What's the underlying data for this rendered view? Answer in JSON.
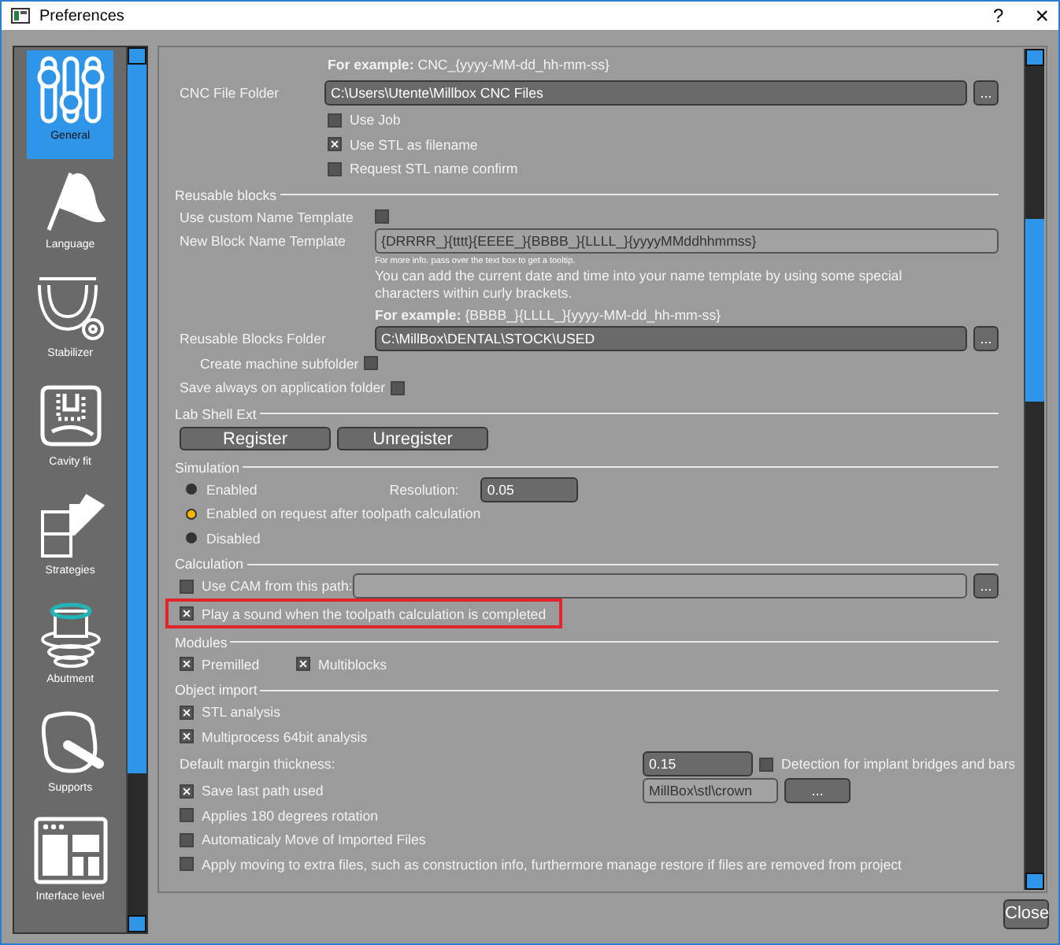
{
  "window": {
    "title": "Preferences",
    "help": "?",
    "close": "×"
  },
  "sidebar": {
    "items": [
      {
        "label": "General",
        "selected": true
      },
      {
        "label": "Language",
        "selected": false
      },
      {
        "label": "Stabilizer",
        "selected": false
      },
      {
        "label": "Cavity fit",
        "selected": false
      },
      {
        "label": "Strategies",
        "selected": false
      },
      {
        "label": "Abutment",
        "selected": false
      },
      {
        "label": "Supports",
        "selected": false
      },
      {
        "label": "Interface level",
        "selected": false
      }
    ]
  },
  "sections": [
    {
      "rows": [
        {
          "kind": "example",
          "text": "**For example:** CNC_{yyyy-MM-dd_hh-mm-ss}"
        },
        {
          "kind": "path",
          "label": "CNC File Folder",
          "value": "C:\\Users\\Utente\\Millbox CNC Files",
          "browse": "..."
        },
        {
          "kind": "checkbox",
          "label": "Use Job",
          "checked": false
        },
        {
          "kind": "checkbox",
          "label": "Use STL as filename",
          "checked": true
        },
        {
          "kind": "checkbox",
          "label": "Request STL name confirm",
          "checked": false
        }
      ]
    },
    {
      "title": "Reusable blocks",
      "rows": [
        {
          "kind": "label_check",
          "label": "Use custom Name Template",
          "checked": false
        },
        {
          "kind": "field",
          "label": "New Block Name Template",
          "value": "{DRRRR_}{tttt}{EEEE_}{BBBB_}{LLLL_}{yyyyMMddhhmmss}",
          "disabled": true
        },
        {
          "kind": "hint",
          "text": "For more info. pass over the text box to get a tooltip."
        },
        {
          "kind": "note",
          "text": "You can add the current date and time into your name template by using some special characters within curly brackets."
        },
        {
          "kind": "example",
          "text": "**For example:** {BBBB_}{LLLL_}{yyyy-MM-dd_hh-mm-ss}"
        },
        {
          "kind": "path",
          "label": "Reusable Blocks Folder",
          "value": "C:\\MillBox\\DENTAL\\STOCK\\USED",
          "browse": "..."
        },
        {
          "kind": "sub_check",
          "label": "Create machine subfolder",
          "checked": false
        },
        {
          "kind": "inline_check",
          "label": "Save always on application folder",
          "checked": false
        }
      ]
    },
    {
      "title": "Lab Shell Ext",
      "rows": [
        {
          "kind": "buttons",
          "buttons": [
            "Register",
            "Unregister"
          ]
        }
      ]
    },
    {
      "title": "Simulation",
      "rows": [
        {
          "kind": "radio",
          "label": "Enabled",
          "selected": false,
          "extra": {
            "label": "Resolution:",
            "value": "0.05"
          }
        },
        {
          "kind": "radio",
          "label": "Enabled on request after toolpath calculation",
          "selected": true
        },
        {
          "kind": "radio",
          "label": "Disabled",
          "selected": false
        }
      ]
    },
    {
      "title": "Calculation",
      "rows": [
        {
          "kind": "check_path",
          "label": "Use CAM from this path:",
          "checked": false,
          "browse": "..."
        },
        {
          "kind": "checkbox",
          "label": "Play a sound when the toolpath calculation is completed",
          "checked": true,
          "highlighted": true
        }
      ]
    },
    {
      "title": "Modules",
      "rows": [
        {
          "kind": "check_row",
          "items": [
            {
              "label": "Premilled",
              "checked": true
            },
            {
              "label": "Multiblocks",
              "checked": true
            }
          ]
        }
      ]
    },
    {
      "title": "Object import",
      "rows": [
        {
          "kind": "checkbox",
          "label": "STL analysis",
          "checked": true
        },
        {
          "kind": "checkbox",
          "label": "Multiprocess 64bit analysis",
          "checked": true
        },
        {
          "kind": "margin",
          "label": "Default margin thickness:",
          "value": "0.15",
          "check": {
            "label": "Detection for implant bridges and bars",
            "checked": false
          }
        },
        {
          "kind": "check_path",
          "label": "Save last path used",
          "checked": true,
          "value": "MillBox\\stl\\crown",
          "browse": "...",
          "short": true
        },
        {
          "kind": "checkbox",
          "label": "Applies 180 degrees rotation",
          "checked": false
        },
        {
          "kind": "checkbox",
          "label": "Automaticaly Move of Imported Files",
          "checked": false
        },
        {
          "kind": "checkbox",
          "label": "Apply moving to extra files, such as construction info, furthermore manage restore if files are removed from project",
          "checked": false
        }
      ]
    }
  ],
  "footer": {
    "close": "Close"
  }
}
